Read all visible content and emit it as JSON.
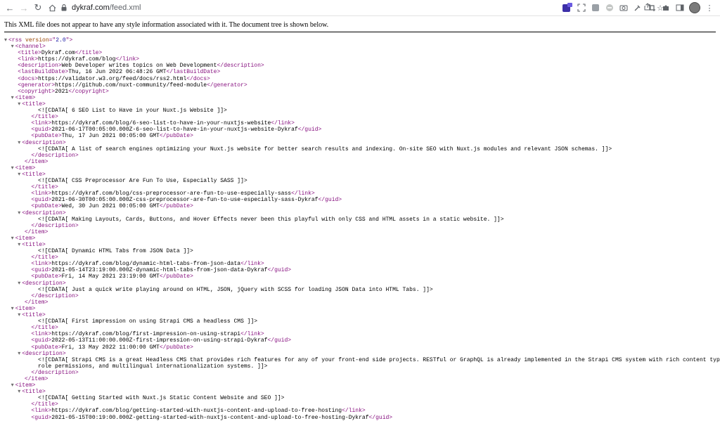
{
  "browser": {
    "url_host": "dykraf.com",
    "url_path": "/feed.xml"
  },
  "banner_text": "This XML file does not appear to have any style information associated with it. The document tree is shown below.",
  "rss": {
    "open_tag": "<rss ",
    "attr_name": "version",
    "attr_eq": "=\"",
    "attr_value": "2.0",
    "attr_close": "\">",
    "channel_open": "<channel>"
  },
  "lines": [
    {
      "i": 2,
      "a": false,
      "pre": "<title>",
      "text": "Dykraf.com",
      "post": "</title>"
    },
    {
      "i": 2,
      "a": false,
      "pre": "<link>",
      "text": "https://dykraf.com/blog",
      "post": "</link>"
    },
    {
      "i": 2,
      "a": false,
      "pre": "<description>",
      "text": "Web Developer writes topics on Web Development",
      "post": "</description>"
    },
    {
      "i": 2,
      "a": false,
      "pre": "<lastBuildDate>",
      "text": "Thu, 16 Jun 2022 06:48:26 GMT",
      "post": "</lastBuildDate>"
    },
    {
      "i": 2,
      "a": false,
      "pre": "<docs>",
      "text": "https://validator.w3.org/feed/docs/rss2.html",
      "post": "</docs>"
    },
    {
      "i": 2,
      "a": false,
      "pre": "<generator>",
      "text": "https://github.com/nuxt-community/feed-module",
      "post": "</generator>"
    },
    {
      "i": 2,
      "a": false,
      "pre": "<copyright>",
      "text": "2021",
      "post": "</copyright>"
    },
    {
      "i": 2,
      "a": true,
      "pre": "<item>",
      "text": "",
      "post": ""
    },
    {
      "i": 3,
      "a": true,
      "pre": "<title>",
      "text": "",
      "post": ""
    },
    {
      "i": 5,
      "a": false,
      "pre": "",
      "text": "<![CDATA[ 6 SEO List to Have in your Nuxt.js Website ]]>",
      "post": ""
    },
    {
      "i": 4,
      "a": false,
      "pre": "</title>",
      "text": "",
      "post": ""
    },
    {
      "i": 4,
      "a": false,
      "pre": "<link>",
      "text": "https://dykraf.com/blog/6-seo-list-to-have-in-your-nuxtjs-website",
      "post": "</link>"
    },
    {
      "i": 4,
      "a": false,
      "pre": "<guid>",
      "text": "2021-06-17T00:05:00.000Z-6-seo-list-to-have-in-your-nuxtjs-website-Dykraf",
      "post": "</guid>"
    },
    {
      "i": 4,
      "a": false,
      "pre": "<pubDate>",
      "text": "Thu, 17 Jun 2021 00:05:00 GMT",
      "post": "</pubDate>"
    },
    {
      "i": 3,
      "a": true,
      "pre": "<description>",
      "text": "",
      "post": ""
    },
    {
      "i": 5,
      "a": false,
      "pre": "",
      "text": "<![CDATA[ A list of search engines optimizing your Nuxt.js website for better search results and indexing. On-site SEO with Nuxt.js modules and relevant JSON schemas. ]]>",
      "post": ""
    },
    {
      "i": 4,
      "a": false,
      "pre": "</description>",
      "text": "",
      "post": ""
    },
    {
      "i": 3,
      "a": false,
      "pre": "</item>",
      "text": "",
      "post": ""
    },
    {
      "i": 2,
      "a": true,
      "pre": "<item>",
      "text": "",
      "post": ""
    },
    {
      "i": 3,
      "a": true,
      "pre": "<title>",
      "text": "",
      "post": ""
    },
    {
      "i": 5,
      "a": false,
      "pre": "",
      "text": "<![CDATA[ CSS Preprocessor Are Fun To Use, Especially SASS ]]>",
      "post": ""
    },
    {
      "i": 4,
      "a": false,
      "pre": "</title>",
      "text": "",
      "post": ""
    },
    {
      "i": 4,
      "a": false,
      "pre": "<link>",
      "text": "https://dykraf.com/blog/css-preprocessor-are-fun-to-use-especially-sass",
      "post": "</link>"
    },
    {
      "i": 4,
      "a": false,
      "pre": "<guid>",
      "text": "2021-06-30T00:05:00.000Z-css-preprocessor-are-fun-to-use-especially-sass-Dykraf",
      "post": "</guid>"
    },
    {
      "i": 4,
      "a": false,
      "pre": "<pubDate>",
      "text": "Wed, 30 Jun 2021 00:05:00 GMT",
      "post": "</pubDate>"
    },
    {
      "i": 3,
      "a": true,
      "pre": "<description>",
      "text": "",
      "post": ""
    },
    {
      "i": 5,
      "a": false,
      "pre": "",
      "text": "<![CDATA[ Making Layouts, Cards, Buttons, and Hover Effects never been this playful with only CSS and HTML assets in a static website. ]]>",
      "post": ""
    },
    {
      "i": 4,
      "a": false,
      "pre": "</description>",
      "text": "",
      "post": ""
    },
    {
      "i": 3,
      "a": false,
      "pre": "</item>",
      "text": "",
      "post": ""
    },
    {
      "i": 2,
      "a": true,
      "pre": "<item>",
      "text": "",
      "post": ""
    },
    {
      "i": 3,
      "a": true,
      "pre": "<title>",
      "text": "",
      "post": ""
    },
    {
      "i": 5,
      "a": false,
      "pre": "",
      "text": "<![CDATA[ Dynamic HTML Tabs from JSON Data ]]>",
      "post": ""
    },
    {
      "i": 4,
      "a": false,
      "pre": "</title>",
      "text": "",
      "post": ""
    },
    {
      "i": 4,
      "a": false,
      "pre": "<link>",
      "text": "https://dykraf.com/blog/dynamic-html-tabs-from-json-data",
      "post": "</link>"
    },
    {
      "i": 4,
      "a": false,
      "pre": "<guid>",
      "text": "2021-05-14T23:19:00.000Z-dynamic-html-tabs-from-json-data-Dykraf",
      "post": "</guid>"
    },
    {
      "i": 4,
      "a": false,
      "pre": "<pubDate>",
      "text": "Fri, 14 May 2021 23:19:00 GMT",
      "post": "</pubDate>"
    },
    {
      "i": 3,
      "a": true,
      "pre": "<description>",
      "text": "",
      "post": ""
    },
    {
      "i": 5,
      "a": false,
      "pre": "",
      "text": "<![CDATA[ Just a quick write playing around on HTML, JSON, jQuery with SCSS for loading JSON Data into HTML Tabs. ]]>",
      "post": ""
    },
    {
      "i": 4,
      "a": false,
      "pre": "</description>",
      "text": "",
      "post": ""
    },
    {
      "i": 3,
      "a": false,
      "pre": "</item>",
      "text": "",
      "post": ""
    },
    {
      "i": 2,
      "a": true,
      "pre": "<item>",
      "text": "",
      "post": ""
    },
    {
      "i": 3,
      "a": true,
      "pre": "<title>",
      "text": "",
      "post": ""
    },
    {
      "i": 5,
      "a": false,
      "pre": "",
      "text": "<![CDATA[ First impression on using Strapi CMS a headless CMS ]]>",
      "post": ""
    },
    {
      "i": 4,
      "a": false,
      "pre": "</title>",
      "text": "",
      "post": ""
    },
    {
      "i": 4,
      "a": false,
      "pre": "<link>",
      "text": "https://dykraf.com/blog/first-impression-on-using-strapi",
      "post": "</link>"
    },
    {
      "i": 4,
      "a": false,
      "pre": "<guid>",
      "text": "2022-05-13T11:00:00.000Z-first-impression-on-using-strapi-Dykraf",
      "post": "</guid>"
    },
    {
      "i": 4,
      "a": false,
      "pre": "<pubDate>",
      "text": "Fri, 13 May 2022 11:00:00 GMT",
      "post": "</pubDate>"
    },
    {
      "i": 3,
      "a": true,
      "pre": "<description>",
      "text": "",
      "post": ""
    },
    {
      "i": 5,
      "a": false,
      "pre": "",
      "text": "<![CDATA[ Strapi CMS is a great Headless CMS that provides rich features for any of your front-end side projects. RESTful or GraphQL is already implemented in the Strapi CMS system with rich content types,",
      "post": ""
    },
    {
      "i": 5,
      "a": false,
      "pre": "",
      "text": "role permissions, and multilingual internationalization systems. ]]>",
      "post": ""
    },
    {
      "i": 4,
      "a": false,
      "pre": "</description>",
      "text": "",
      "post": ""
    },
    {
      "i": 3,
      "a": false,
      "pre": "</item>",
      "text": "",
      "post": ""
    },
    {
      "i": 2,
      "a": true,
      "pre": "<item>",
      "text": "",
      "post": ""
    },
    {
      "i": 3,
      "a": true,
      "pre": "<title>",
      "text": "",
      "post": ""
    },
    {
      "i": 5,
      "a": false,
      "pre": "",
      "text": "<![CDATA[ Getting Started with Nuxt.js Static Content Website and SEO ]]>",
      "post": ""
    },
    {
      "i": 4,
      "a": false,
      "pre": "</title>",
      "text": "",
      "post": ""
    },
    {
      "i": 4,
      "a": false,
      "pre": "<link>",
      "text": "https://dykraf.com/blog/getting-started-with-nuxtjs-content-and-upload-to-free-hosting",
      "post": "</link>"
    },
    {
      "i": 4,
      "a": false,
      "pre": "<guid>",
      "text": "2021-05-15T00:19:00.000Z-getting-started-with-nuxtjs-content-and-upload-to-free-hosting-Dykraf",
      "post": "</guid>"
    }
  ]
}
